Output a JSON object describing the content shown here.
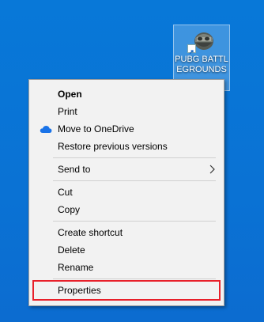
{
  "desktop": {
    "background_color": "#0a74d6",
    "icon": {
      "icon_name": "pubg-helmet-icon",
      "label": "PUBG BATTLEGROUNDS"
    }
  },
  "context_menu": {
    "items": [
      {
        "label": "Open",
        "bold": true
      },
      {
        "label": "Print"
      },
      {
        "label": "Move to OneDrive",
        "icon": "onedrive-cloud-icon",
        "icon_color": "#1a73e8"
      },
      {
        "label": "Restore previous versions"
      },
      {
        "label": "Send to",
        "has_submenu": true,
        "submenu_icon": "chevron-right-icon"
      },
      {
        "label": "Cut"
      },
      {
        "label": "Copy"
      },
      {
        "label": "Create shortcut"
      },
      {
        "label": "Delete"
      },
      {
        "label": "Rename"
      },
      {
        "label": "Properties",
        "highlighted": true,
        "highlight_color": "#e8202a"
      }
    ]
  }
}
